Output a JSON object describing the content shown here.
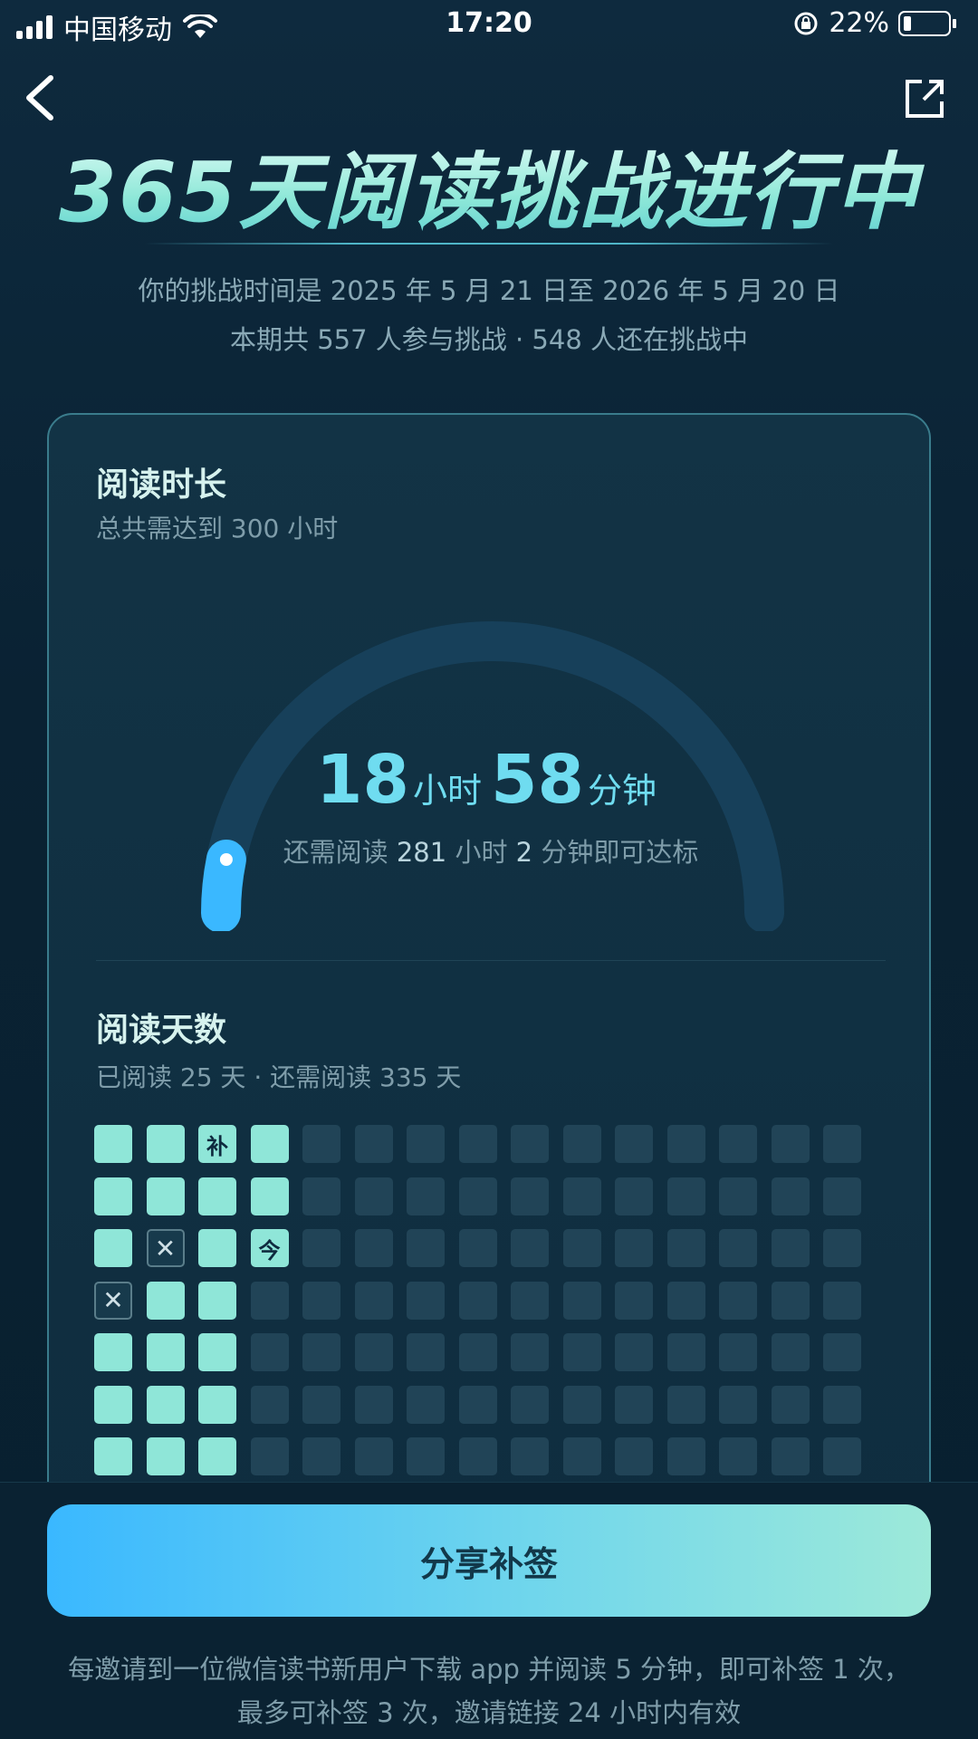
{
  "status_bar": {
    "carrier": "中国移动",
    "time": "17:20",
    "battery": "22%"
  },
  "header": {
    "title": "365天阅读挑战进行中",
    "period": "你的挑战时间是 2025 年 5 月 21 日至 2026 年 5 月 20 日",
    "participants": "本期共 557 人参与挑战 · 548 人还在挑战中"
  },
  "reading_time": {
    "title": "阅读时长",
    "target": "总共需达到 300 小时",
    "hours": "18",
    "hours_unit": "小时",
    "minutes": "58",
    "minutes_unit": "分钟",
    "remaining_prefix": "还需阅读",
    "remaining_hours": "281",
    "remaining_mid": "小时",
    "remaining_minutes": "2",
    "remaining_suffix": "分钟即可达标",
    "progress_fraction": 0.063
  },
  "reading_days": {
    "title": "阅读天数",
    "summary": "已阅读 25 天 · 还需阅读 335 天",
    "grid_rows": 7,
    "grid_cols": 15,
    "cells": [
      [
        "done",
        "done",
        "makeup",
        "done",
        "e",
        "e",
        "e",
        "e",
        "e",
        "e",
        "e",
        "e",
        "e",
        "e",
        "e"
      ],
      [
        "done",
        "done",
        "done",
        "done",
        "e",
        "e",
        "e",
        "e",
        "e",
        "e",
        "e",
        "e",
        "e",
        "e",
        "e"
      ],
      [
        "done",
        "miss",
        "done",
        "today",
        "e",
        "e",
        "e",
        "e",
        "e",
        "e",
        "e",
        "e",
        "e",
        "e",
        "e"
      ],
      [
        "miss",
        "done",
        "done",
        "e",
        "e",
        "e",
        "e",
        "e",
        "e",
        "e",
        "e",
        "e",
        "e",
        "e",
        "e"
      ],
      [
        "done",
        "done",
        "done",
        "e",
        "e",
        "e",
        "e",
        "e",
        "e",
        "e",
        "e",
        "e",
        "e",
        "e",
        "e"
      ],
      [
        "done",
        "done",
        "done",
        "e",
        "e",
        "e",
        "e",
        "e",
        "e",
        "e",
        "e",
        "e",
        "e",
        "e",
        "e"
      ],
      [
        "done",
        "done",
        "done",
        "e",
        "e",
        "e",
        "e",
        "e",
        "e",
        "e",
        "e",
        "e",
        "e",
        "e",
        "e"
      ]
    ],
    "makeup_label": "补",
    "today_label": "今",
    "miss_label": "✕"
  },
  "footer": {
    "button_label": "分享补签",
    "notice": "每邀请到一位微信读书新用户下载 app 并阅读 5 分钟，即可补签 1 次，最多可补签 3 次，邀请链接 24 小时内有效"
  },
  "colors": {
    "accent": "#3ab8ff",
    "done_cell": "#8fe6d8",
    "empty_cell": "#214457"
  }
}
